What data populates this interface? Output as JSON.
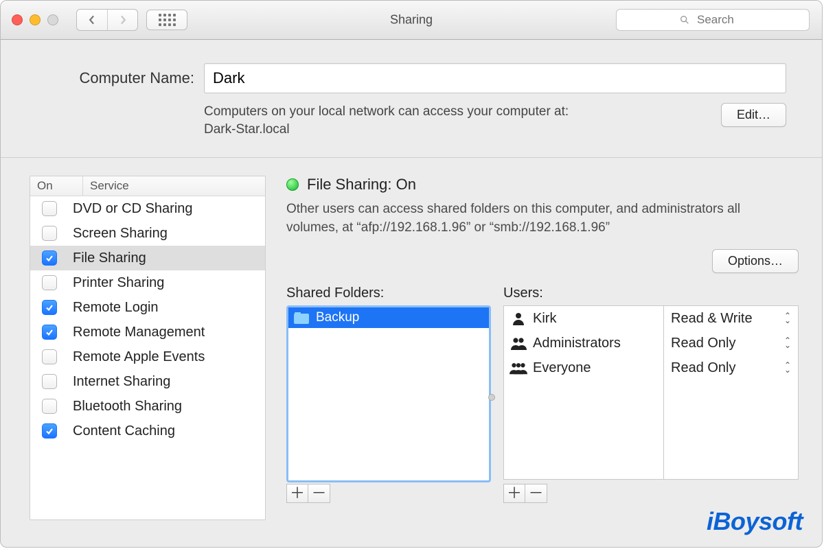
{
  "toolbar": {
    "title": "Sharing",
    "search_placeholder": "Search"
  },
  "header": {
    "computer_name_label": "Computer Name:",
    "computer_name_value": "Dark",
    "access_desc_line1": "Computers on your local network can access your computer at:",
    "access_desc_line2": "Dark-Star.local",
    "edit_label": "Edit…"
  },
  "services": {
    "col_on": "On",
    "col_service": "Service",
    "items": [
      {
        "label": "DVD or CD Sharing",
        "on": false,
        "selected": false
      },
      {
        "label": "Screen Sharing",
        "on": false,
        "selected": false
      },
      {
        "label": "File Sharing",
        "on": true,
        "selected": true
      },
      {
        "label": "Printer Sharing",
        "on": false,
        "selected": false
      },
      {
        "label": "Remote Login",
        "on": true,
        "selected": false
      },
      {
        "label": "Remote Management",
        "on": true,
        "selected": false
      },
      {
        "label": "Remote Apple Events",
        "on": false,
        "selected": false
      },
      {
        "label": "Internet Sharing",
        "on": false,
        "selected": false
      },
      {
        "label": "Bluetooth Sharing",
        "on": false,
        "selected": false
      },
      {
        "label": "Content Caching",
        "on": true,
        "selected": false
      }
    ]
  },
  "detail": {
    "status_title": "File Sharing: On",
    "status_desc": "Other users can access shared folders on this computer, and administrators all volumes, at “afp://192.168.1.96” or “smb://192.168.1.96”",
    "options_label": "Options…",
    "shared_folders_label": "Shared Folders:",
    "users_label": "Users:",
    "folders": [
      {
        "name": "Backup",
        "selected": true
      }
    ],
    "users": [
      {
        "name": "Kirk",
        "icon": "person",
        "permission": "Read & Write"
      },
      {
        "name": "Administrators",
        "icon": "group-2",
        "permission": "Read Only"
      },
      {
        "name": "Everyone",
        "icon": "group-3",
        "permission": "Read Only"
      }
    ]
  },
  "watermark": "iBoysoft"
}
